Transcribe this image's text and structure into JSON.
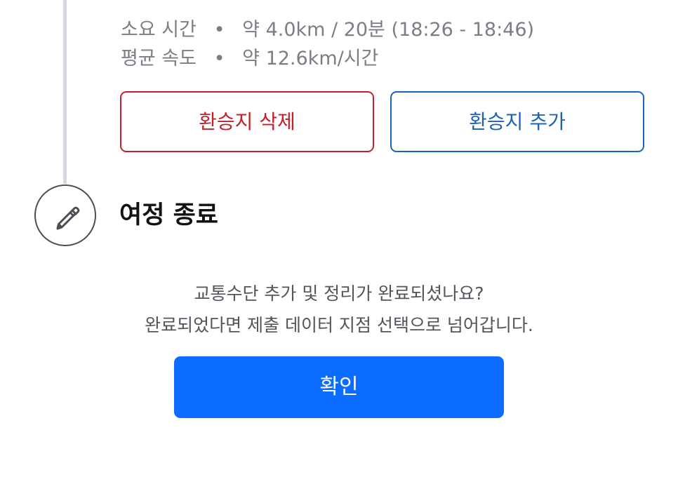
{
  "route_info": {
    "duration_label": "소요 시간",
    "separator": "•",
    "duration_value": "약 4.0km / 20분 (18:26 - 18:46)",
    "speed_label": "평균 속도",
    "speed_value": "약 12.6km/시간"
  },
  "transfer_actions": {
    "delete_label": "환승지 삭제",
    "add_label": "환승지 추가"
  },
  "journey_end": {
    "icon": "pencil-icon",
    "title": "여정 종료",
    "message_line_1": "교통수단 추가 및 정리가 완료되셨나요?",
    "message_line_2": "완료되었다면 제출 데이터 지점 선택으로 넘어갑니다.",
    "confirm_label": "확인"
  },
  "colors": {
    "delete_red": "#c31f2a",
    "add_blue": "#1d62b7",
    "confirm_blue": "#0b6cff",
    "timeline_gray": "#d7d8de"
  }
}
